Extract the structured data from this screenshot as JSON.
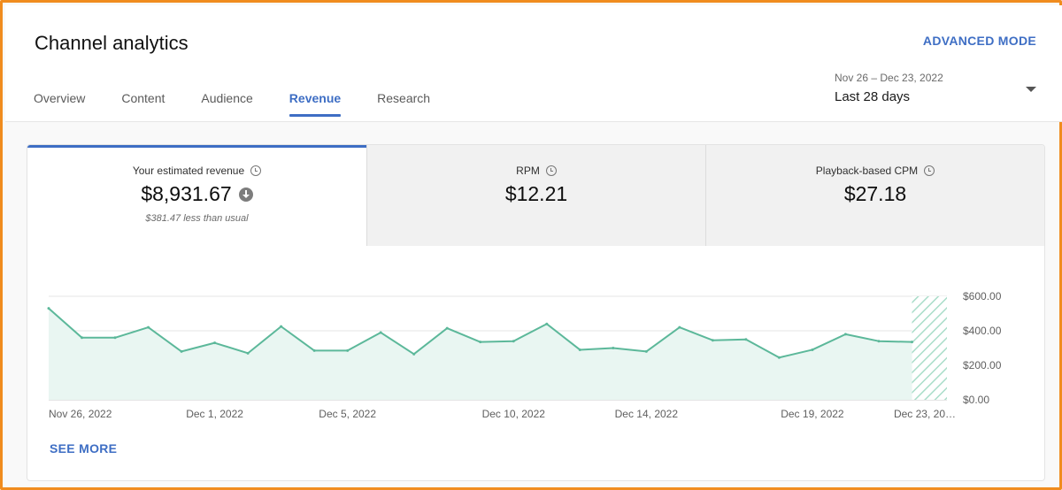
{
  "page": {
    "title": "Channel analytics",
    "advanced_mode": "ADVANCED MODE"
  },
  "tabs": [
    {
      "label": "Overview"
    },
    {
      "label": "Content"
    },
    {
      "label": "Audience"
    },
    {
      "label": "Revenue",
      "active": true
    },
    {
      "label": "Research"
    }
  ],
  "date_picker": {
    "range": "Nov 26 – Dec 23, 2022",
    "label": "Last 28 days",
    "icon": "dropdown-caret"
  },
  "metrics": [
    {
      "label": "Your estimated revenue",
      "value": "$8,931.67",
      "sub": "$381.47 less than usual",
      "icon": "clock-icon",
      "trend_icon": "down-arrow-icon"
    },
    {
      "label": "RPM",
      "value": "$12.21",
      "icon": "clock-icon"
    },
    {
      "label": "Playback-based CPM",
      "value": "$27.18",
      "icon": "clock-icon"
    }
  ],
  "colors": {
    "accent": "#3e6ec4",
    "line": "#5cb89a",
    "fill": "#e9f6f2"
  },
  "chart_data": {
    "type": "area",
    "x": [
      "Nov 26, 2022",
      "Nov 27, 2022",
      "Nov 28, 2022",
      "Nov 29, 2022",
      "Nov 30, 2022",
      "Dec 1, 2022",
      "Dec 2, 2022",
      "Dec 3, 2022",
      "Dec 4, 2022",
      "Dec 5, 2022",
      "Dec 6, 2022",
      "Dec 7, 2022",
      "Dec 8, 2022",
      "Dec 9, 2022",
      "Dec 10, 2022",
      "Dec 11, 2022",
      "Dec 12, 2022",
      "Dec 13, 2022",
      "Dec 14, 2022",
      "Dec 15, 2022",
      "Dec 16, 2022",
      "Dec 17, 2022",
      "Dec 18, 2022",
      "Dec 19, 2022",
      "Dec 20, 2022",
      "Dec 21, 2022",
      "Dec 22, 2022",
      "Dec 23, 2022"
    ],
    "values": [
      530,
      360,
      360,
      420,
      280,
      330,
      270,
      425,
      285,
      285,
      390,
      265,
      415,
      335,
      340,
      440,
      290,
      300,
      280,
      420,
      345,
      350,
      245,
      290,
      380,
      340,
      335,
      335
    ],
    "ylim": [
      0,
      600
    ],
    "yticks": [
      "$600.00",
      "$400.00",
      "$200.00",
      "$0.00"
    ],
    "ytick_values": [
      600,
      400,
      200,
      0
    ],
    "xticks": [
      {
        "label": "Nov 26, 2022",
        "index": 0
      },
      {
        "label": "Dec 1, 2022",
        "index": 5
      },
      {
        "label": "Dec 5, 2022",
        "index": 9
      },
      {
        "label": "Dec 10, 2022",
        "index": 14
      },
      {
        "label": "Dec 14, 2022",
        "index": 18
      },
      {
        "label": "Dec 19, 2022",
        "index": 23
      },
      {
        "label": "Dec 23, 20…",
        "index": 27
      }
    ],
    "grid": true,
    "hatched_last": true
  },
  "see_more": "SEE MORE"
}
